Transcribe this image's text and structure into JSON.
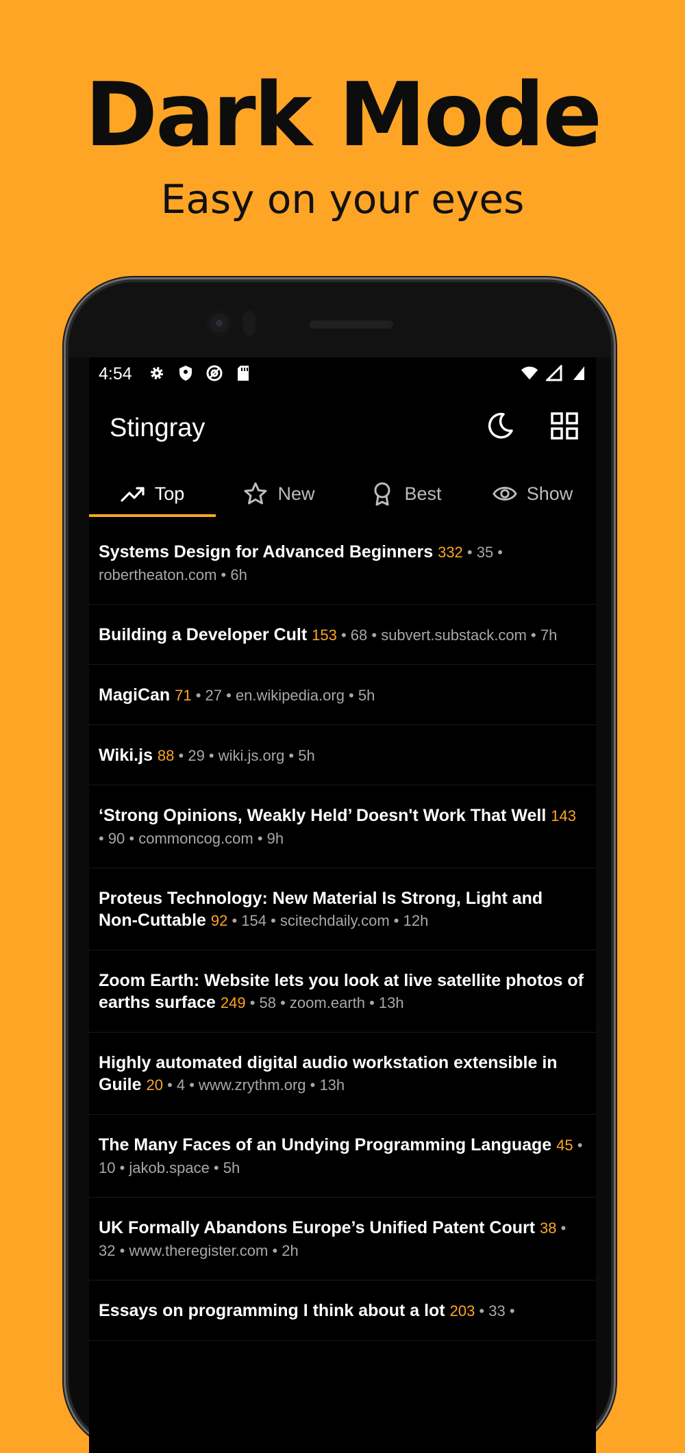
{
  "hero": {
    "title": "Dark Mode",
    "subtitle": "Easy on your eyes"
  },
  "colors": {
    "accent": "#FFA526",
    "background": "#FFA526",
    "screen": "#000000"
  },
  "status_bar": {
    "time": "4:54",
    "left_icons": [
      "settings-icon",
      "shield-icon",
      "at-sign-icon",
      "sd-card-icon"
    ],
    "right_icons": [
      "wifi-icon",
      "signal-icon",
      "battery-icon"
    ]
  },
  "app_bar": {
    "title": "Stingray",
    "actions": [
      "moon-icon",
      "grid-icon"
    ]
  },
  "tabs": [
    {
      "label": "Top",
      "icon": "trending-up-icon",
      "active": true
    },
    {
      "label": "New",
      "icon": "star-icon",
      "active": false
    },
    {
      "label": "Best",
      "icon": "award-icon",
      "active": false
    },
    {
      "label": "Show",
      "icon": "eye-icon",
      "active": false
    }
  ],
  "stories": [
    {
      "title": "Systems Design for Advanced Beginners",
      "points": "332",
      "meta": " • 35 • robertheaton.com • 6h"
    },
    {
      "title": "Building a Developer Cult",
      "points": "153",
      "meta": " • 68 • subvert.substack.com • 7h"
    },
    {
      "title": "MagiCan",
      "points": "71",
      "meta": " • 27 • en.wikipedia.org • 5h"
    },
    {
      "title": "Wiki.js",
      "points": "88",
      "meta": " • 29 • wiki.js.org • 5h"
    },
    {
      "title": "‘Strong Opinions, Weakly Held’ Doesn't Work That Well",
      "points": "143",
      "meta": " • 90 • commoncog.com • 9h"
    },
    {
      "title": "Proteus Technology: New Material Is Strong, Light and Non-Cuttable",
      "points": "92",
      "meta": " • 154 • scitechdaily.com • 12h"
    },
    {
      "title": "Zoom Earth: Website lets you look at live satellite photos of earths surface",
      "points": "249",
      "meta": " • 58 • zoom.earth • 13h"
    },
    {
      "title": "Highly automated digital audio workstation extensible in Guile",
      "points": "20",
      "meta": " • 4 • www.zrythm.org • 13h"
    },
    {
      "title": "The Many Faces of an Undying Programming Language",
      "points": "45",
      "meta": " • 10 • jakob.space • 5h"
    },
    {
      "title": "UK Formally Abandons Europe’s Unified Patent Court",
      "points": "38",
      "meta": " • 32 • www.theregister.com • 2h"
    },
    {
      "title": "Essays on programming I think about a lot",
      "points": "203",
      "meta": " • 33 •"
    }
  ]
}
